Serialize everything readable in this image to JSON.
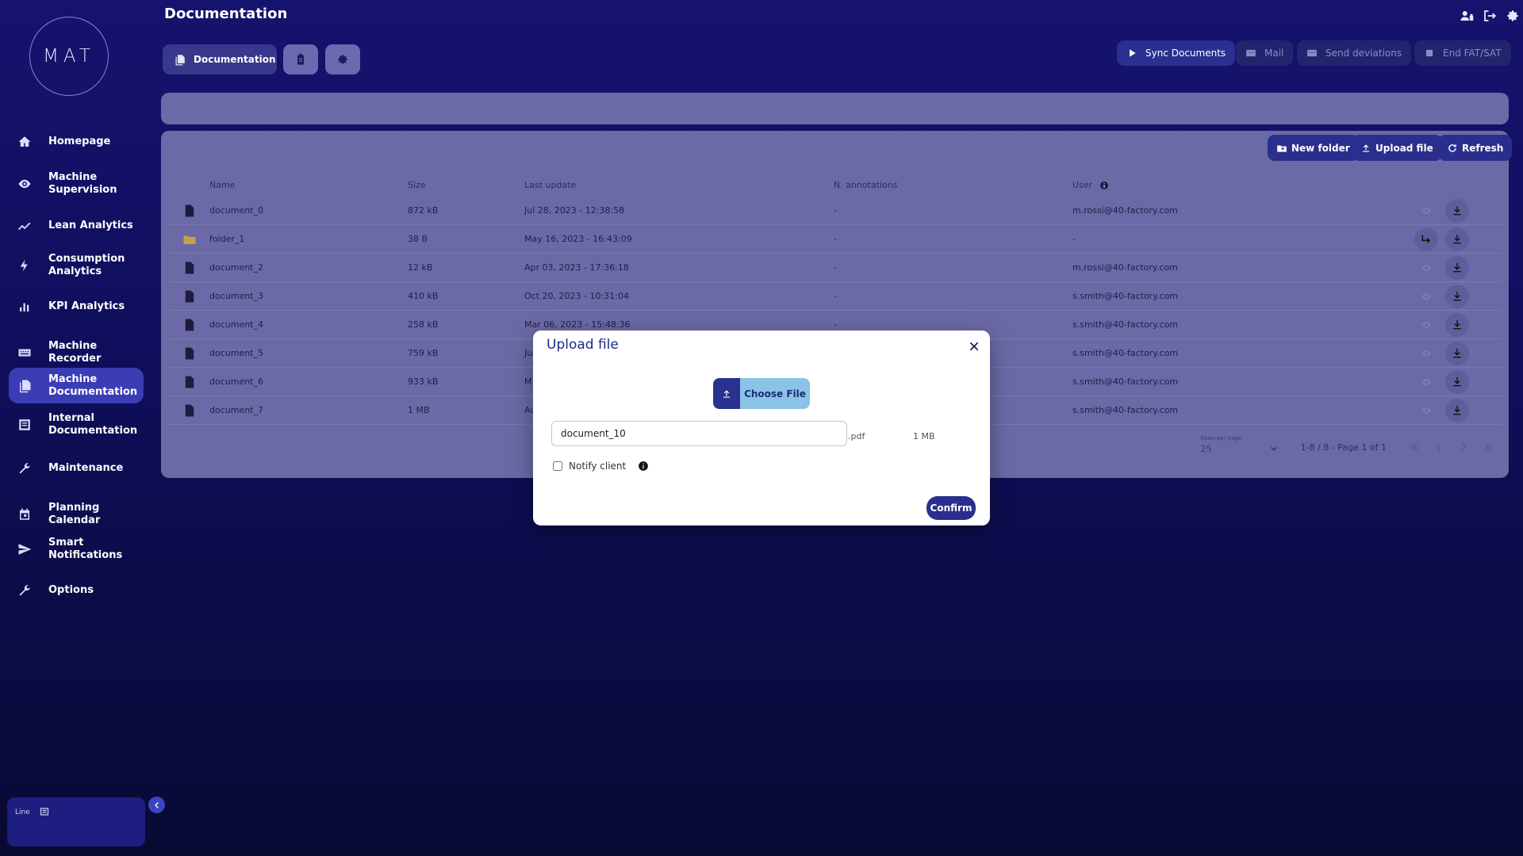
{
  "app": {
    "logo": "MAT",
    "page_title": "Documentation"
  },
  "sidebar": {
    "items": [
      {
        "label": "Homepage",
        "icon": "home-icon"
      },
      {
        "label": "Machine\nSupervision",
        "icon": "eye-icon"
      },
      {
        "label": "Lean Analytics",
        "icon": "trend-icon"
      },
      {
        "label": "Consumption\nAnalytics",
        "icon": "bolt-icon"
      },
      {
        "label": "KPI Analytics",
        "icon": "bar-chart-icon"
      },
      {
        "label": "Machine Recorder",
        "icon": "recorder-icon"
      },
      {
        "label": "Machine\nDocumentation",
        "icon": "documents-icon",
        "active": true
      },
      {
        "label": "Internal\nDocumentation",
        "icon": "folder-doc-icon"
      },
      {
        "label": "Maintenance",
        "icon": "wrench-icon"
      },
      {
        "label": "Planning Calendar",
        "icon": "calendar-icon"
      },
      {
        "label": "Smart\nNotifications",
        "icon": "send-icon"
      },
      {
        "label": "Options",
        "icon": "wrench-icon"
      }
    ],
    "line_label": "Line"
  },
  "toolbar": {
    "tab_documentation": "Documentation",
    "sync": "Sync Documents",
    "mail": "Mail",
    "send_deviations": "Send deviations",
    "end_fat": "End FAT/SAT"
  },
  "files": {
    "new_folder": "New folder",
    "upload_file": "Upload file",
    "refresh": "Refresh",
    "columns": {
      "name": "Name",
      "size": "Size",
      "last_update": "Last update",
      "annotations": "N. annotations",
      "user": "User"
    },
    "rows": [
      {
        "type": "file",
        "name": "document_0",
        "size": "872 kB",
        "updated": "Jul 28, 2023 - 12:38:58",
        "annotations": "-",
        "user": "m.rossi@40-factory.com"
      },
      {
        "type": "folder",
        "name": "folder_1",
        "size": "38 B",
        "updated": "May 16, 2023 - 16:43:09",
        "annotations": "-",
        "user": "-"
      },
      {
        "type": "file",
        "name": "document_2",
        "size": "12 kB",
        "updated": "Apr 03, 2023 - 17:36:18",
        "annotations": "-",
        "user": "m.rossi@40-factory.com"
      },
      {
        "type": "file",
        "name": "document_3",
        "size": "410 kB",
        "updated": "Oct 20, 2023 - 10:31:04",
        "annotations": "-",
        "user": "s.smith@40-factory.com"
      },
      {
        "type": "file",
        "name": "document_4",
        "size": "258 kB",
        "updated": "Mar 06, 2023 - 15:48:36",
        "annotations": "-",
        "user": "s.smith@40-factory.com"
      },
      {
        "type": "file",
        "name": "document_5",
        "size": "759 kB",
        "updated": "Ju",
        "annotations": "",
        "user": "s.smith@40-factory.com"
      },
      {
        "type": "file",
        "name": "document_6",
        "size": "933 kB",
        "updated": "M",
        "annotations": "",
        "user": "s.smith@40-factory.com"
      },
      {
        "type": "file",
        "name": "document_7",
        "size": "1 MB",
        "updated": "Au",
        "annotations": "",
        "user": "s.smith@40-factory.com"
      }
    ],
    "pager": {
      "rows_per_page_label": "Rows per page",
      "rows_per_page": "25",
      "range": "1-8 / 8 - Page 1 of 1"
    }
  },
  "modal": {
    "title": "Upload file",
    "choose_file": "Choose File",
    "file_name": "document_10",
    "extension": ".pdf",
    "file_size": "1 MB",
    "notify_label": "Notify client",
    "confirm": "Confirm"
  },
  "colors": {
    "accent": "#2a2f8e",
    "panel": "#6b6aa6",
    "active_nav": "#3a3db4"
  }
}
